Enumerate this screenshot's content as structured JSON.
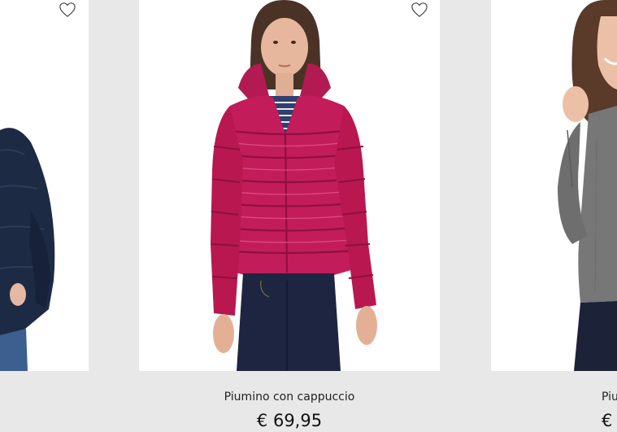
{
  "products": [
    {
      "name": "",
      "price": "",
      "image": "navy-puffer-jacket"
    },
    {
      "name": "Piumino con cappuccio",
      "price": "€ 69,95",
      "image": "magenta-hooded-puffer-jacket"
    },
    {
      "name": "Piu",
      "price": "€",
      "image": "grey-knit-sweater"
    }
  ],
  "icons": {
    "wishlist": "heart-outline-icon"
  },
  "colors": {
    "page_background": "#e8e8e8",
    "card_background": "#ffffff",
    "text": "#222222"
  }
}
